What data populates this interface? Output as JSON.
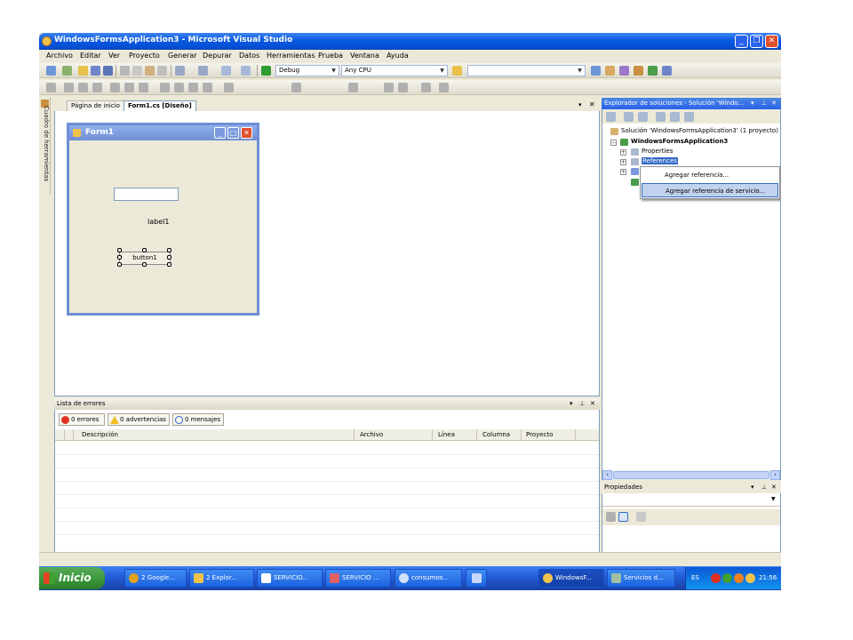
{
  "window": {
    "title": "WindowsFormsApplication3 - Microsoft Visual Studio"
  },
  "menu": [
    "Archivo",
    "Editar",
    "Ver",
    "Proyecto",
    "Generar",
    "Depurar",
    "Datos",
    "Herramientas",
    "Prueba",
    "Ventana",
    "Ayuda"
  ],
  "toolbar": {
    "configuration": "Debug",
    "platform": "Any CPU"
  },
  "toolbox": {
    "label": "Cuadro de herramientas"
  },
  "tabs": {
    "start_page": "Página de inicio",
    "designer": "Form1.cs [Diseño]"
  },
  "form": {
    "title": "Form1",
    "label": "label1",
    "button": "button1"
  },
  "errors": {
    "title": "Lista de errores",
    "errors_button": "0 errores",
    "warnings_button": "0 advertencias",
    "messages_button": "0 mensajes",
    "columns": [
      "Descripción",
      "Archivo",
      "Línea",
      "Columna",
      "Proyecto"
    ]
  },
  "solution": {
    "title": "Explorador de soluciones - Solución 'Windo...",
    "root": "Solución 'WindowsFormsApplication3' (1 proyecto)",
    "project": "WindowsFormsApplication3",
    "properties": "Properties",
    "references": "References"
  },
  "context_menu": {
    "items": [
      "Agregar referencia...",
      "Agregar referencia de servicio..."
    ]
  },
  "properties_panel": {
    "title": "Propiedades"
  },
  "taskbar": {
    "start": "Inicio",
    "tasks": [
      "2 Google...",
      "2 Explor...",
      "SERVICIO...",
      "SERVICIO ...",
      "consumos...",
      "WindowsF...",
      "Servicios d..."
    ],
    "language": "ES",
    "clock": "21:56"
  },
  "colors": {
    "title_blue": "#0a5ae0",
    "selection": "#c1d2ee",
    "taskbar_blue": "#245edb",
    "start_green": "#3c9a3c"
  }
}
